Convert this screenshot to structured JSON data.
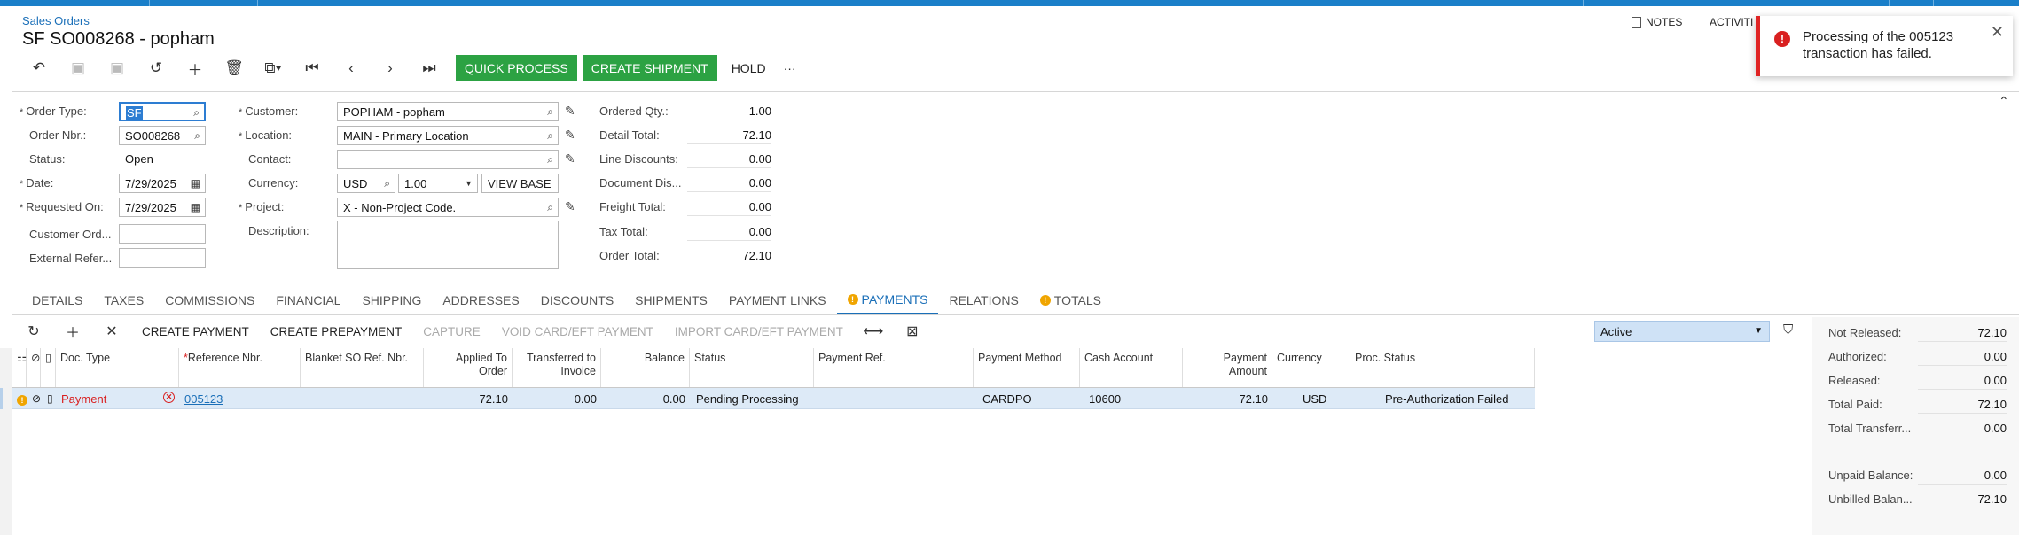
{
  "header": {
    "breadcrumb": "Sales Orders",
    "title": "SF SO008268 - popham",
    "notes_label": "NOTES",
    "activities_label": "ACTIVITI"
  },
  "toolbar": {
    "quick_process": "QUICK PROCESS",
    "create_shipment": "CREATE SHIPMENT",
    "hold": "HOLD",
    "more": "···"
  },
  "toast": {
    "message": "Processing of the 005123 transaction has failed.",
    "color": "#e02424"
  },
  "form": {
    "order_type_label": "Order Type:",
    "order_type_value": "SF",
    "order_nbr_label": "Order Nbr.:",
    "order_nbr_value": "SO008268",
    "status_label": "Status:",
    "status_value": "Open",
    "date_label": "Date:",
    "date_value": "7/29/2025",
    "requested_on_label": "Requested On:",
    "requested_on_value": "7/29/2025",
    "customer_ord_label": "Customer Ord...",
    "external_ref_label": "External Refer...",
    "customer_label": "Customer:",
    "customer_value": "POPHAM - popham",
    "location_label": "Location:",
    "location_value": "MAIN - Primary Location",
    "contact_label": "Contact:",
    "currency_label": "Currency:",
    "currency_value": "USD",
    "rate_value": "1.00",
    "view_base": "VIEW BASE",
    "project_label": "Project:",
    "project_value": "X - Non-Project Code.",
    "description_label": "Description:"
  },
  "totals": {
    "ordered_qty_label": "Ordered Qty.:",
    "ordered_qty": "1.00",
    "detail_total_label": "Detail Total:",
    "detail_total": "72.10",
    "line_discounts_label": "Line Discounts:",
    "line_discounts": "0.00",
    "document_dis_label": "Document Dis...",
    "document_dis": "0.00",
    "freight_total_label": "Freight Total:",
    "freight_total": "0.00",
    "tax_total_label": "Tax Total:",
    "tax_total": "0.00",
    "order_total_label": "Order Total:",
    "order_total": "72.10"
  },
  "tabs": [
    "DETAILS",
    "TAXES",
    "COMMISSIONS",
    "FINANCIAL",
    "SHIPPING",
    "ADDRESSES",
    "DISCOUNTS",
    "SHIPMENTS",
    "PAYMENT LINKS",
    "PAYMENTS",
    "RELATIONS",
    "TOTALS"
  ],
  "grid_toolbar": {
    "create_payment": "CREATE PAYMENT",
    "create_prepayment": "CREATE PREPAYMENT",
    "capture": "CAPTURE",
    "void_card": "VOID CARD/EFT PAYMENT",
    "import_card": "IMPORT CARD/EFT PAYMENT",
    "status_filter": "Active"
  },
  "grid": {
    "headers": {
      "doc_type": "Doc. Type",
      "reference_nbr": "Reference Nbr.",
      "blanket": "Blanket SO Ref. Nbr.",
      "applied": "Applied To Order",
      "transferred": "Transferred to Invoice",
      "balance": "Balance",
      "status": "Status",
      "payment_ref": "Payment Ref.",
      "payment_method": "Payment Method",
      "cash_account": "Cash Account",
      "payment_amount": "Payment Amount",
      "currency": "Currency",
      "proc_status": "Proc. Status"
    },
    "row": {
      "doc_type": "Payment",
      "reference_nbr": "005123",
      "applied": "72.10",
      "transferred": "0.00",
      "balance": "0.00",
      "status": "Pending Processing",
      "payment_method": "CARDPO",
      "cash_account": "10600",
      "payment_amount": "72.10",
      "currency": "USD",
      "proc_status": "Pre-Authorization Failed"
    }
  },
  "summary": {
    "not_released_label": "Not Released:",
    "not_released": "72.10",
    "authorized_label": "Authorized:",
    "authorized": "0.00",
    "released_label": "Released:",
    "released": "0.00",
    "total_paid_label": "Total Paid:",
    "total_paid": "72.10",
    "total_transferred_label": "Total Transferr...",
    "total_transferred": "0.00",
    "unpaid_balance_label": "Unpaid Balance:",
    "unpaid_balance": "0.00",
    "unbilled_balance_label": "Unbilled Balan...",
    "unbilled_balance": "72.10"
  }
}
